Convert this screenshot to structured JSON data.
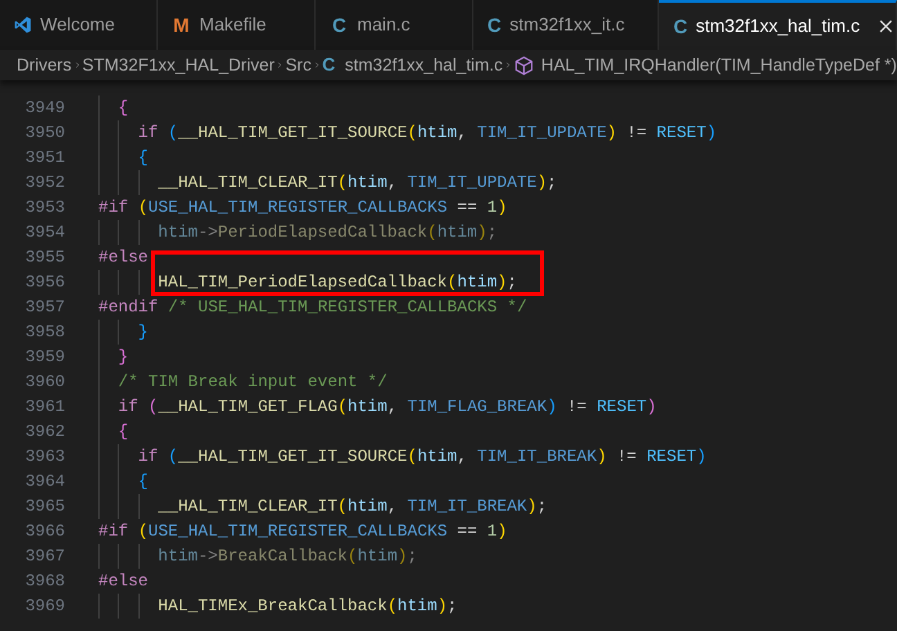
{
  "tabs": [
    {
      "kind": "logo",
      "label": "Welcome",
      "selected": false
    },
    {
      "kind": "letter",
      "glyph": "M",
      "color": "#e37933",
      "label": "Makefile",
      "selected": false
    },
    {
      "kind": "letter",
      "glyph": "C",
      "color": "#519aba",
      "label": "main.c",
      "selected": false
    },
    {
      "kind": "letter",
      "glyph": "C",
      "color": "#519aba",
      "label": "stm32f1xx_it.c",
      "selected": false
    },
    {
      "kind": "letter",
      "glyph": "C",
      "color": "#519aba",
      "label": "stm32f1xx_hal_tim.c",
      "selected": true
    }
  ],
  "breadcrumb": [
    {
      "kind": "folder",
      "label": "Drivers"
    },
    {
      "kind": "folder",
      "label": "STM32F1xx_HAL_Driver"
    },
    {
      "kind": "folder",
      "label": "Src"
    },
    {
      "kind": "file",
      "glyph": "C",
      "label": "stm32f1xx_hal_tim.c"
    },
    {
      "kind": "symbol",
      "label": "HAL_TIM_IRQHandler(TIM_HandleTypeDef *)"
    }
  ],
  "code": {
    "lines": [
      {
        "number": "3949",
        "inactive": false,
        "highlighted": false,
        "tokens": [
          {
            "kind": "b2",
            "t": "  {"
          }
        ]
      },
      {
        "number": "3950",
        "inactive": false,
        "highlighted": false,
        "tokens": [
          {
            "kind": "keyword",
            "t": "    if "
          },
          {
            "kind": "b3",
            "t": "("
          },
          {
            "kind": "macro",
            "t": "__HAL_TIM_GET_IT_SOURCE"
          },
          {
            "kind": "b1",
            "t": "("
          },
          {
            "kind": "var",
            "t": "htim"
          },
          {
            "kind": "punct",
            "t": ", "
          },
          {
            "kind": "const",
            "t": "TIM_IT_UPDATE"
          },
          {
            "kind": "b1",
            "t": ")"
          },
          {
            "kind": "punct",
            "t": " != "
          },
          {
            "kind": "enum",
            "t": "RESET"
          },
          {
            "kind": "b3",
            "t": ")"
          }
        ]
      },
      {
        "number": "3951",
        "inactive": false,
        "highlighted": false,
        "tokens": [
          {
            "kind": "b3",
            "t": "    {"
          }
        ]
      },
      {
        "number": "3952",
        "inactive": false,
        "highlighted": false,
        "tokens": [
          {
            "kind": "macro",
            "t": "      __HAL_TIM_CLEAR_IT"
          },
          {
            "kind": "b1",
            "t": "("
          },
          {
            "kind": "var",
            "t": "htim"
          },
          {
            "kind": "punct",
            "t": ", "
          },
          {
            "kind": "const",
            "t": "TIM_IT_UPDATE"
          },
          {
            "kind": "b1",
            "t": ")"
          },
          {
            "kind": "punct",
            "t": ";"
          }
        ]
      },
      {
        "number": "3953",
        "inactive": false,
        "highlighted": false,
        "tokens": [
          {
            "kind": "preproc",
            "t": "#if "
          },
          {
            "kind": "b1",
            "t": "("
          },
          {
            "kind": "const",
            "t": "USE_HAL_TIM_REGISTER_CALLBACKS"
          },
          {
            "kind": "punct",
            "t": " == "
          },
          {
            "kind": "number",
            "t": "1"
          },
          {
            "kind": "b1",
            "t": ")"
          }
        ]
      },
      {
        "number": "3954",
        "inactive": true,
        "highlighted": false,
        "tokens": [
          {
            "kind": "var",
            "t": "      htim"
          },
          {
            "kind": "punct",
            "t": "->"
          },
          {
            "kind": "macro",
            "t": "PeriodElapsedCallback"
          },
          {
            "kind": "b1",
            "t": "("
          },
          {
            "kind": "var",
            "t": "htim"
          },
          {
            "kind": "b1",
            "t": ")"
          },
          {
            "kind": "punct",
            "t": ";"
          }
        ]
      },
      {
        "number": "3955",
        "inactive": false,
        "highlighted": false,
        "tokens": [
          {
            "kind": "preproc",
            "t": "#else"
          }
        ]
      },
      {
        "number": "3956",
        "inactive": false,
        "highlighted": true,
        "tokens": [
          {
            "kind": "macro",
            "t": "      HAL_TIM_PeriodElapsedCallback"
          },
          {
            "kind": "b1",
            "t": "("
          },
          {
            "kind": "var",
            "t": "htim"
          },
          {
            "kind": "b1",
            "t": ")"
          },
          {
            "kind": "punct",
            "t": ";"
          }
        ]
      },
      {
        "number": "3957",
        "inactive": false,
        "highlighted": false,
        "tokens": [
          {
            "kind": "preproc",
            "t": "#endif "
          },
          {
            "kind": "comment",
            "t": "/* USE_HAL_TIM_REGISTER_CALLBACKS */"
          }
        ]
      },
      {
        "number": "3958",
        "inactive": false,
        "highlighted": false,
        "tokens": [
          {
            "kind": "b3",
            "t": "    }"
          }
        ]
      },
      {
        "number": "3959",
        "inactive": false,
        "highlighted": false,
        "tokens": [
          {
            "kind": "b2",
            "t": "  }"
          }
        ]
      },
      {
        "number": "3960",
        "inactive": false,
        "highlighted": false,
        "tokens": [
          {
            "kind": "comment",
            "t": "  /* TIM Break input event */"
          }
        ]
      },
      {
        "number": "3961",
        "inactive": false,
        "highlighted": false,
        "tokens": [
          {
            "kind": "keyword",
            "t": "  if "
          },
          {
            "kind": "b2",
            "t": "("
          },
          {
            "kind": "macro",
            "t": "__HAL_TIM_GET_FLAG"
          },
          {
            "kind": "b1",
            "t": "("
          },
          {
            "kind": "var",
            "t": "htim"
          },
          {
            "kind": "punct",
            "t": ", "
          },
          {
            "kind": "const",
            "t": "TIM_FLAG_BREAK"
          },
          {
            "kind": "b3",
            "t": ")"
          },
          {
            "kind": "punct",
            "t": " != "
          },
          {
            "kind": "enum",
            "t": "RESET"
          },
          {
            "kind": "b2",
            "t": ")"
          }
        ]
      },
      {
        "number": "3962",
        "inactive": false,
        "highlighted": false,
        "tokens": [
          {
            "kind": "b2",
            "t": "  {"
          }
        ]
      },
      {
        "number": "3963",
        "inactive": false,
        "highlighted": false,
        "tokens": [
          {
            "kind": "keyword",
            "t": "    if "
          },
          {
            "kind": "b3",
            "t": "("
          },
          {
            "kind": "macro",
            "t": "__HAL_TIM_GET_IT_SOURCE"
          },
          {
            "kind": "b1",
            "t": "("
          },
          {
            "kind": "var",
            "t": "htim"
          },
          {
            "kind": "punct",
            "t": ", "
          },
          {
            "kind": "const",
            "t": "TIM_IT_BREAK"
          },
          {
            "kind": "b1",
            "t": ")"
          },
          {
            "kind": "punct",
            "t": " != "
          },
          {
            "kind": "enum",
            "t": "RESET"
          },
          {
            "kind": "b3",
            "t": ")"
          }
        ]
      },
      {
        "number": "3964",
        "inactive": false,
        "highlighted": false,
        "tokens": [
          {
            "kind": "b3",
            "t": "    {"
          }
        ]
      },
      {
        "number": "3965",
        "inactive": false,
        "highlighted": false,
        "tokens": [
          {
            "kind": "macro",
            "t": "      __HAL_TIM_CLEAR_IT"
          },
          {
            "kind": "b1",
            "t": "("
          },
          {
            "kind": "var",
            "t": "htim"
          },
          {
            "kind": "punct",
            "t": ", "
          },
          {
            "kind": "const",
            "t": "TIM_IT_BREAK"
          },
          {
            "kind": "b1",
            "t": ")"
          },
          {
            "kind": "punct",
            "t": ";"
          }
        ]
      },
      {
        "number": "3966",
        "inactive": false,
        "highlighted": false,
        "tokens": [
          {
            "kind": "preproc",
            "t": "#if "
          },
          {
            "kind": "b1",
            "t": "("
          },
          {
            "kind": "const",
            "t": "USE_HAL_TIM_REGISTER_CALLBACKS"
          },
          {
            "kind": "punct",
            "t": " == "
          },
          {
            "kind": "number",
            "t": "1"
          },
          {
            "kind": "b1",
            "t": ")"
          }
        ]
      },
      {
        "number": "3967",
        "inactive": true,
        "highlighted": false,
        "tokens": [
          {
            "kind": "var",
            "t": "      htim"
          },
          {
            "kind": "punct",
            "t": "->"
          },
          {
            "kind": "macro",
            "t": "BreakCallback"
          },
          {
            "kind": "b1",
            "t": "("
          },
          {
            "kind": "var",
            "t": "htim"
          },
          {
            "kind": "b1",
            "t": ")"
          },
          {
            "kind": "punct",
            "t": ";"
          }
        ]
      },
      {
        "number": "3968",
        "inactive": false,
        "highlighted": false,
        "tokens": [
          {
            "kind": "preproc",
            "t": "#else"
          }
        ]
      },
      {
        "number": "3969",
        "inactive": false,
        "highlighted": false,
        "tokens": [
          {
            "kind": "macro",
            "t": "      HAL_TIMEx_BreakCallback"
          },
          {
            "kind": "b1",
            "t": "("
          },
          {
            "kind": "var",
            "t": "htim"
          },
          {
            "kind": "b1",
            "t": ")"
          },
          {
            "kind": "punct",
            "t": ";"
          }
        ]
      }
    ]
  }
}
